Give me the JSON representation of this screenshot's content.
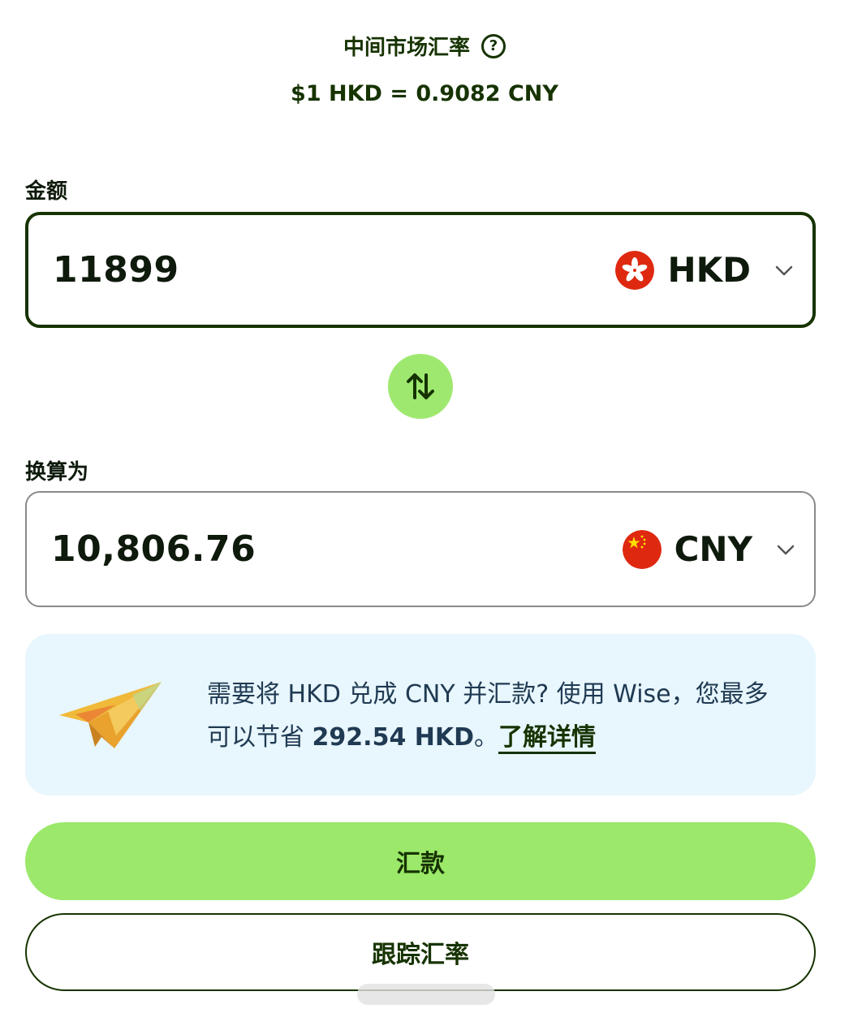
{
  "header": {
    "title": "中间市场汇率",
    "rate_text": "$1 HKD = 0.9082 CNY"
  },
  "amount": {
    "label": "金额",
    "value": "11899",
    "currency": {
      "code": "HKD",
      "flag_icon": "hong-kong-flag-icon"
    }
  },
  "converted": {
    "label": "换算为",
    "value": "10,806.76",
    "currency": {
      "code": "CNY",
      "flag_icon": "china-flag-icon"
    }
  },
  "promo": {
    "text_before": "需要将 HKD 兑成 CNY 并汇款? 使用 Wise，您最多可以节省 ",
    "savings": "292.54 HKD",
    "text_after": "。",
    "link_label": "了解详情"
  },
  "actions": {
    "send_label": "汇款",
    "track_label": "跟踪汇率"
  },
  "colors": {
    "accent_green": "#9fe870",
    "forest_green": "#163300",
    "promo_bg": "#e8f6fd",
    "flag_red": "#de2910"
  }
}
